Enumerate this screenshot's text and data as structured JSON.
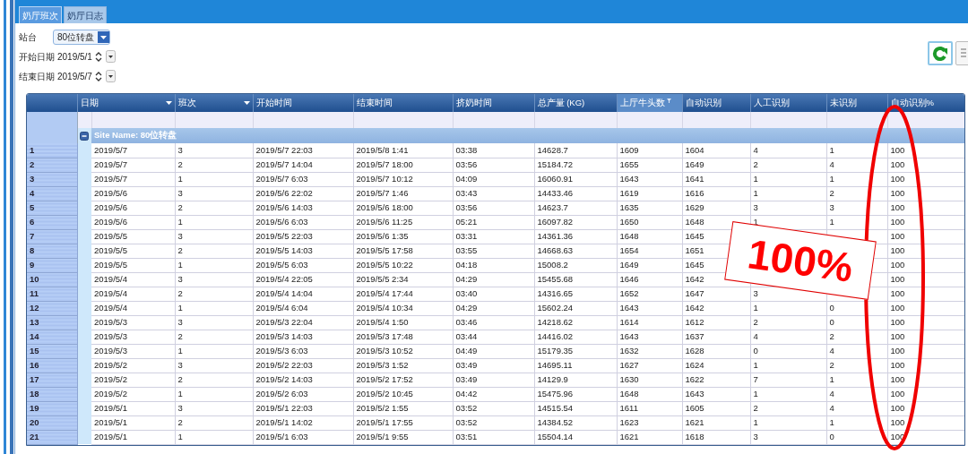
{
  "tabs": [
    {
      "label": "奶厅班次",
      "selected": true
    },
    {
      "label": "奶厅日志",
      "selected": false
    }
  ],
  "filters": {
    "station": {
      "label": "站台",
      "value": "80位转盘"
    },
    "start_date": {
      "label": "开始日期",
      "value": "2019/5/1"
    },
    "end_date": {
      "label": "结束日期",
      "value": "2019/5/7"
    }
  },
  "grid": {
    "columns": [
      {
        "label": "日期",
        "kind": "dropdown"
      },
      {
        "label": "班次",
        "kind": "dropdown"
      },
      {
        "label": "开始时间",
        "kind": "plain"
      },
      {
        "label": "结束时间",
        "kind": "plain"
      },
      {
        "label": "挤奶时间",
        "kind": "plain"
      },
      {
        "label": "总产量 (KG)",
        "kind": "plain"
      },
      {
        "label": "上厅牛头数",
        "kind": "filter"
      },
      {
        "label": "自动识别",
        "kind": "plain"
      },
      {
        "label": "人工识别",
        "kind": "plain"
      },
      {
        "label": "未识别",
        "kind": "plain"
      },
      {
        "label": "自动识别%",
        "kind": "plain"
      }
    ],
    "group": {
      "label": "Site Name: 80位转盘",
      "expanded": true
    },
    "rows": [
      {
        "number": "1",
        "cells": [
          "2019/5/7",
          "3",
          "2019/5/7 22:03",
          "2019/5/8 1:41",
          "03:38",
          "14628.7",
          "1609",
          "1604",
          "4",
          "1",
          "100"
        ]
      },
      {
        "number": "2",
        "cells": [
          "2019/5/7",
          "2",
          "2019/5/7 14:04",
          "2019/5/7 18:00",
          "03:56",
          "15184.72",
          "1655",
          "1649",
          "2",
          "4",
          "100"
        ]
      },
      {
        "number": "3",
        "cells": [
          "2019/5/7",
          "1",
          "2019/5/7 6:03",
          "2019/5/7 10:12",
          "04:09",
          "16060.91",
          "1643",
          "1641",
          "1",
          "1",
          "100"
        ]
      },
      {
        "number": "4",
        "cells": [
          "2019/5/6",
          "3",
          "2019/5/6 22:02",
          "2019/5/7 1:46",
          "03:43",
          "14433.46",
          "1619",
          "1616",
          "1",
          "2",
          "100"
        ]
      },
      {
        "number": "5",
        "cells": [
          "2019/5/6",
          "2",
          "2019/5/6 14:03",
          "2019/5/6 18:00",
          "03:56",
          "14623.7",
          "1635",
          "1629",
          "3",
          "3",
          "100"
        ]
      },
      {
        "number": "6",
        "cells": [
          "2019/5/6",
          "1",
          "2019/5/6 6:03",
          "2019/5/6 11:25",
          "05:21",
          "16097.82",
          "1650",
          "1648",
          "1",
          "1",
          "100"
        ]
      },
      {
        "number": "7",
        "cells": [
          "2019/5/5",
          "3",
          "2019/5/5 22:03",
          "2019/5/6 1:35",
          "03:31",
          "14361.36",
          "1648",
          "1645",
          null,
          null,
          "100"
        ]
      },
      {
        "number": "8",
        "cells": [
          "2019/5/5",
          "2",
          "2019/5/5 14:03",
          "2019/5/5 17:58",
          "03:55",
          "14668.63",
          "1654",
          "1651",
          null,
          null,
          "100"
        ]
      },
      {
        "number": "9",
        "cells": [
          "2019/5/5",
          "1",
          "2019/5/5 6:03",
          "2019/5/5 10:22",
          "04:18",
          "15008.2",
          "1649",
          "1645",
          null,
          null,
          "100"
        ]
      },
      {
        "number": "10",
        "cells": [
          "2019/5/4",
          "3",
          "2019/5/4 22:05",
          "2019/5/5 2:34",
          "04:29",
          "15455.68",
          "1646",
          "1642",
          null,
          null,
          "100"
        ]
      },
      {
        "number": "11",
        "cells": [
          "2019/5/4",
          "2",
          "2019/5/4 14:04",
          "2019/5/4 17:44",
          "03:40",
          "14316.65",
          "1652",
          "1647",
          "3",
          null,
          "100"
        ]
      },
      {
        "number": "12",
        "cells": [
          "2019/5/4",
          "1",
          "2019/5/4 6:04",
          "2019/5/4 10:34",
          "04:29",
          "15602.24",
          "1643",
          "1642",
          "1",
          "0",
          "100"
        ]
      },
      {
        "number": "13",
        "cells": [
          "2019/5/3",
          "3",
          "2019/5/3 22:04",
          "2019/5/4 1:50",
          "03:46",
          "14218.62",
          "1614",
          "1612",
          "2",
          "0",
          "100"
        ]
      },
      {
        "number": "14",
        "cells": [
          "2019/5/3",
          "2",
          "2019/5/3 14:03",
          "2019/5/3 17:48",
          "03:44",
          "14416.02",
          "1643",
          "1637",
          "4",
          "2",
          "100"
        ]
      },
      {
        "number": "15",
        "cells": [
          "2019/5/3",
          "1",
          "2019/5/3 6:03",
          "2019/5/3 10:52",
          "04:49",
          "15179.35",
          "1632",
          "1628",
          "0",
          "4",
          "100"
        ]
      },
      {
        "number": "16",
        "cells": [
          "2019/5/2",
          "3",
          "2019/5/2 22:03",
          "2019/5/3 1:52",
          "03:49",
          "14695.11",
          "1627",
          "1624",
          "1",
          "2",
          "100"
        ]
      },
      {
        "number": "17",
        "cells": [
          "2019/5/2",
          "2",
          "2019/5/2 14:03",
          "2019/5/2 17:52",
          "03:49",
          "14129.9",
          "1630",
          "1622",
          "7",
          "1",
          "100"
        ]
      },
      {
        "number": "18",
        "cells": [
          "2019/5/2",
          "1",
          "2019/5/2 6:03",
          "2019/5/2 10:45",
          "04:42",
          "15475.96",
          "1648",
          "1643",
          "1",
          "4",
          "100"
        ]
      },
      {
        "number": "19",
        "cells": [
          "2019/5/1",
          "3",
          "2019/5/1 22:03",
          "2019/5/2 1:55",
          "03:52",
          "14515.54",
          "1611",
          "1605",
          "2",
          "4",
          "100"
        ]
      },
      {
        "number": "20",
        "cells": [
          "2019/5/1",
          "2",
          "2019/5/1 14:02",
          "2019/5/1 17:55",
          "03:52",
          "14384.52",
          "1623",
          "1621",
          "1",
          "1",
          "100"
        ]
      },
      {
        "number": "21",
        "cells": [
          "2019/5/1",
          "1",
          "2019/5/1 6:03",
          "2019/5/1 9:55",
          "03:51",
          "15504.14",
          "1621",
          "1618",
          "3",
          "0",
          "100"
        ]
      }
    ]
  },
  "annotation": {
    "callout": "100%"
  }
}
